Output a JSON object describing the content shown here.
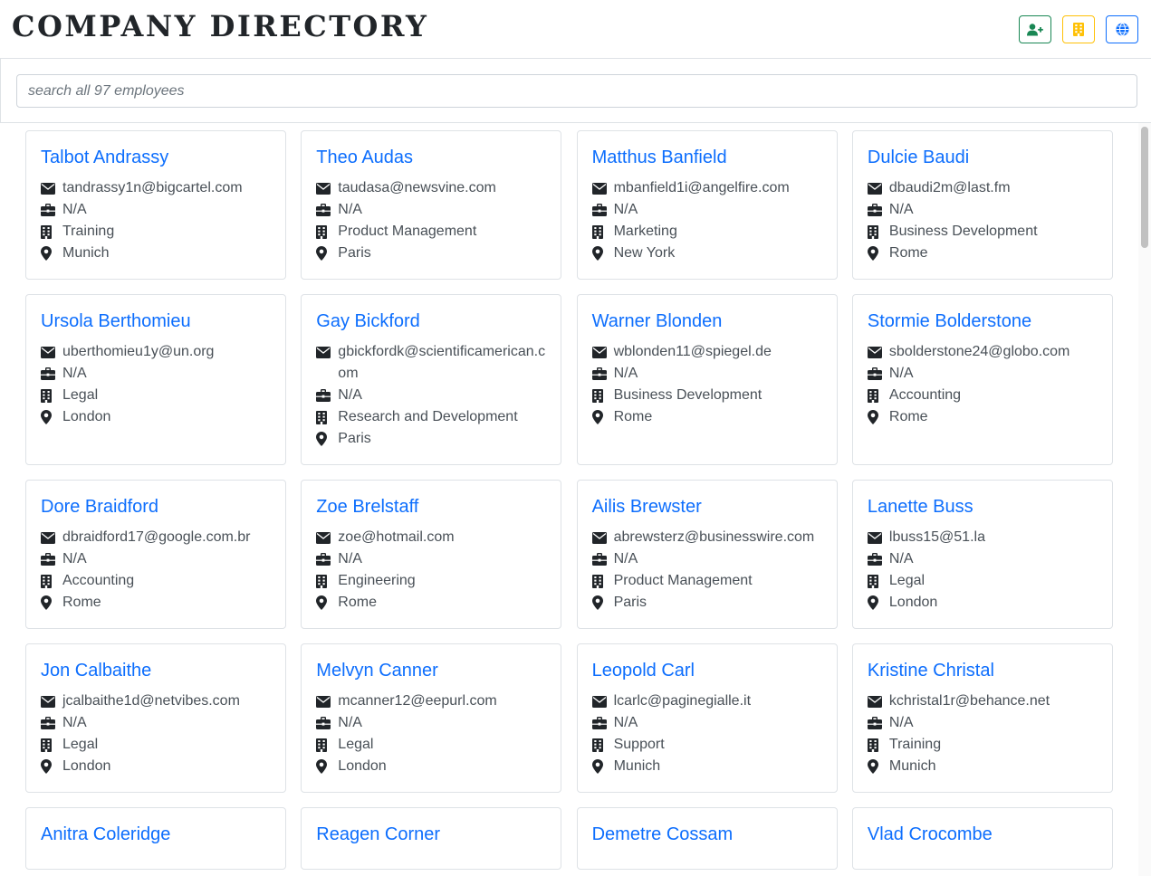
{
  "header": {
    "title": "COMPANY DIRECTORY"
  },
  "search": {
    "placeholder": "search all 97 employees"
  },
  "colors": {
    "accent": "#0d6efd",
    "add": "#198754",
    "department": "#ffc107",
    "location": "#0d6efd"
  },
  "employees": [
    {
      "name": "Talbot Andrassy",
      "email": "tandrassy1n@bigcartel.com",
      "job": "N/A",
      "department": "Training",
      "location": "Munich"
    },
    {
      "name": "Theo Audas",
      "email": "taudasa@newsvine.com",
      "job": "N/A",
      "department": "Product Management",
      "location": "Paris"
    },
    {
      "name": "Matthus Banfield",
      "email": "mbanfield1i@angelfire.com",
      "job": "N/A",
      "department": "Marketing",
      "location": "New York"
    },
    {
      "name": "Dulcie Baudi",
      "email": "dbaudi2m@last.fm",
      "job": "N/A",
      "department": "Business Development",
      "location": "Rome"
    },
    {
      "name": "Ursola Berthomieu",
      "email": "uberthomieu1y@un.org",
      "job": "N/A",
      "department": "Legal",
      "location": "London"
    },
    {
      "name": "Gay Bickford",
      "email": "gbickfordk@scientificamerican.com",
      "job": "N/A",
      "department": "Research and Development",
      "location": "Paris"
    },
    {
      "name": "Warner Blonden",
      "email": "wblonden11@spiegel.de",
      "job": "N/A",
      "department": "Business Development",
      "location": "Rome"
    },
    {
      "name": "Stormie Bolderstone",
      "email": "sbolderstone24@globo.com",
      "job": "N/A",
      "department": "Accounting",
      "location": "Rome"
    },
    {
      "name": "Dore Braidford",
      "email": "dbraidford17@google.com.br",
      "job": "N/A",
      "department": "Accounting",
      "location": "Rome"
    },
    {
      "name": "Zoe Brelstaff",
      "email": "zoe@hotmail.com",
      "job": "N/A",
      "department": "Engineering",
      "location": "Rome"
    },
    {
      "name": "Ailis Brewster",
      "email": "abrewsterz@businesswire.com",
      "job": "N/A",
      "department": "Product Management",
      "location": "Paris"
    },
    {
      "name": "Lanette Buss",
      "email": "lbuss15@51.la",
      "job": "N/A",
      "department": "Legal",
      "location": "London"
    },
    {
      "name": "Jon Calbaithe",
      "email": "jcalbaithe1d@netvibes.com",
      "job": "N/A",
      "department": "Legal",
      "location": "London"
    },
    {
      "name": "Melvyn Canner",
      "email": "mcanner12@eepurl.com",
      "job": "N/A",
      "department": "Legal",
      "location": "London"
    },
    {
      "name": "Leopold Carl",
      "email": "lcarlc@paginegialle.it",
      "job": "N/A",
      "department": "Support",
      "location": "Munich"
    },
    {
      "name": "Kristine Christal",
      "email": "kchristal1r@behance.net",
      "job": "N/A",
      "department": "Training",
      "location": "Munich"
    },
    {
      "name": "Anitra Coleridge"
    },
    {
      "name": "Reagen Corner"
    },
    {
      "name": "Demetre Cossam"
    },
    {
      "name": "Vlad Crocombe"
    }
  ]
}
